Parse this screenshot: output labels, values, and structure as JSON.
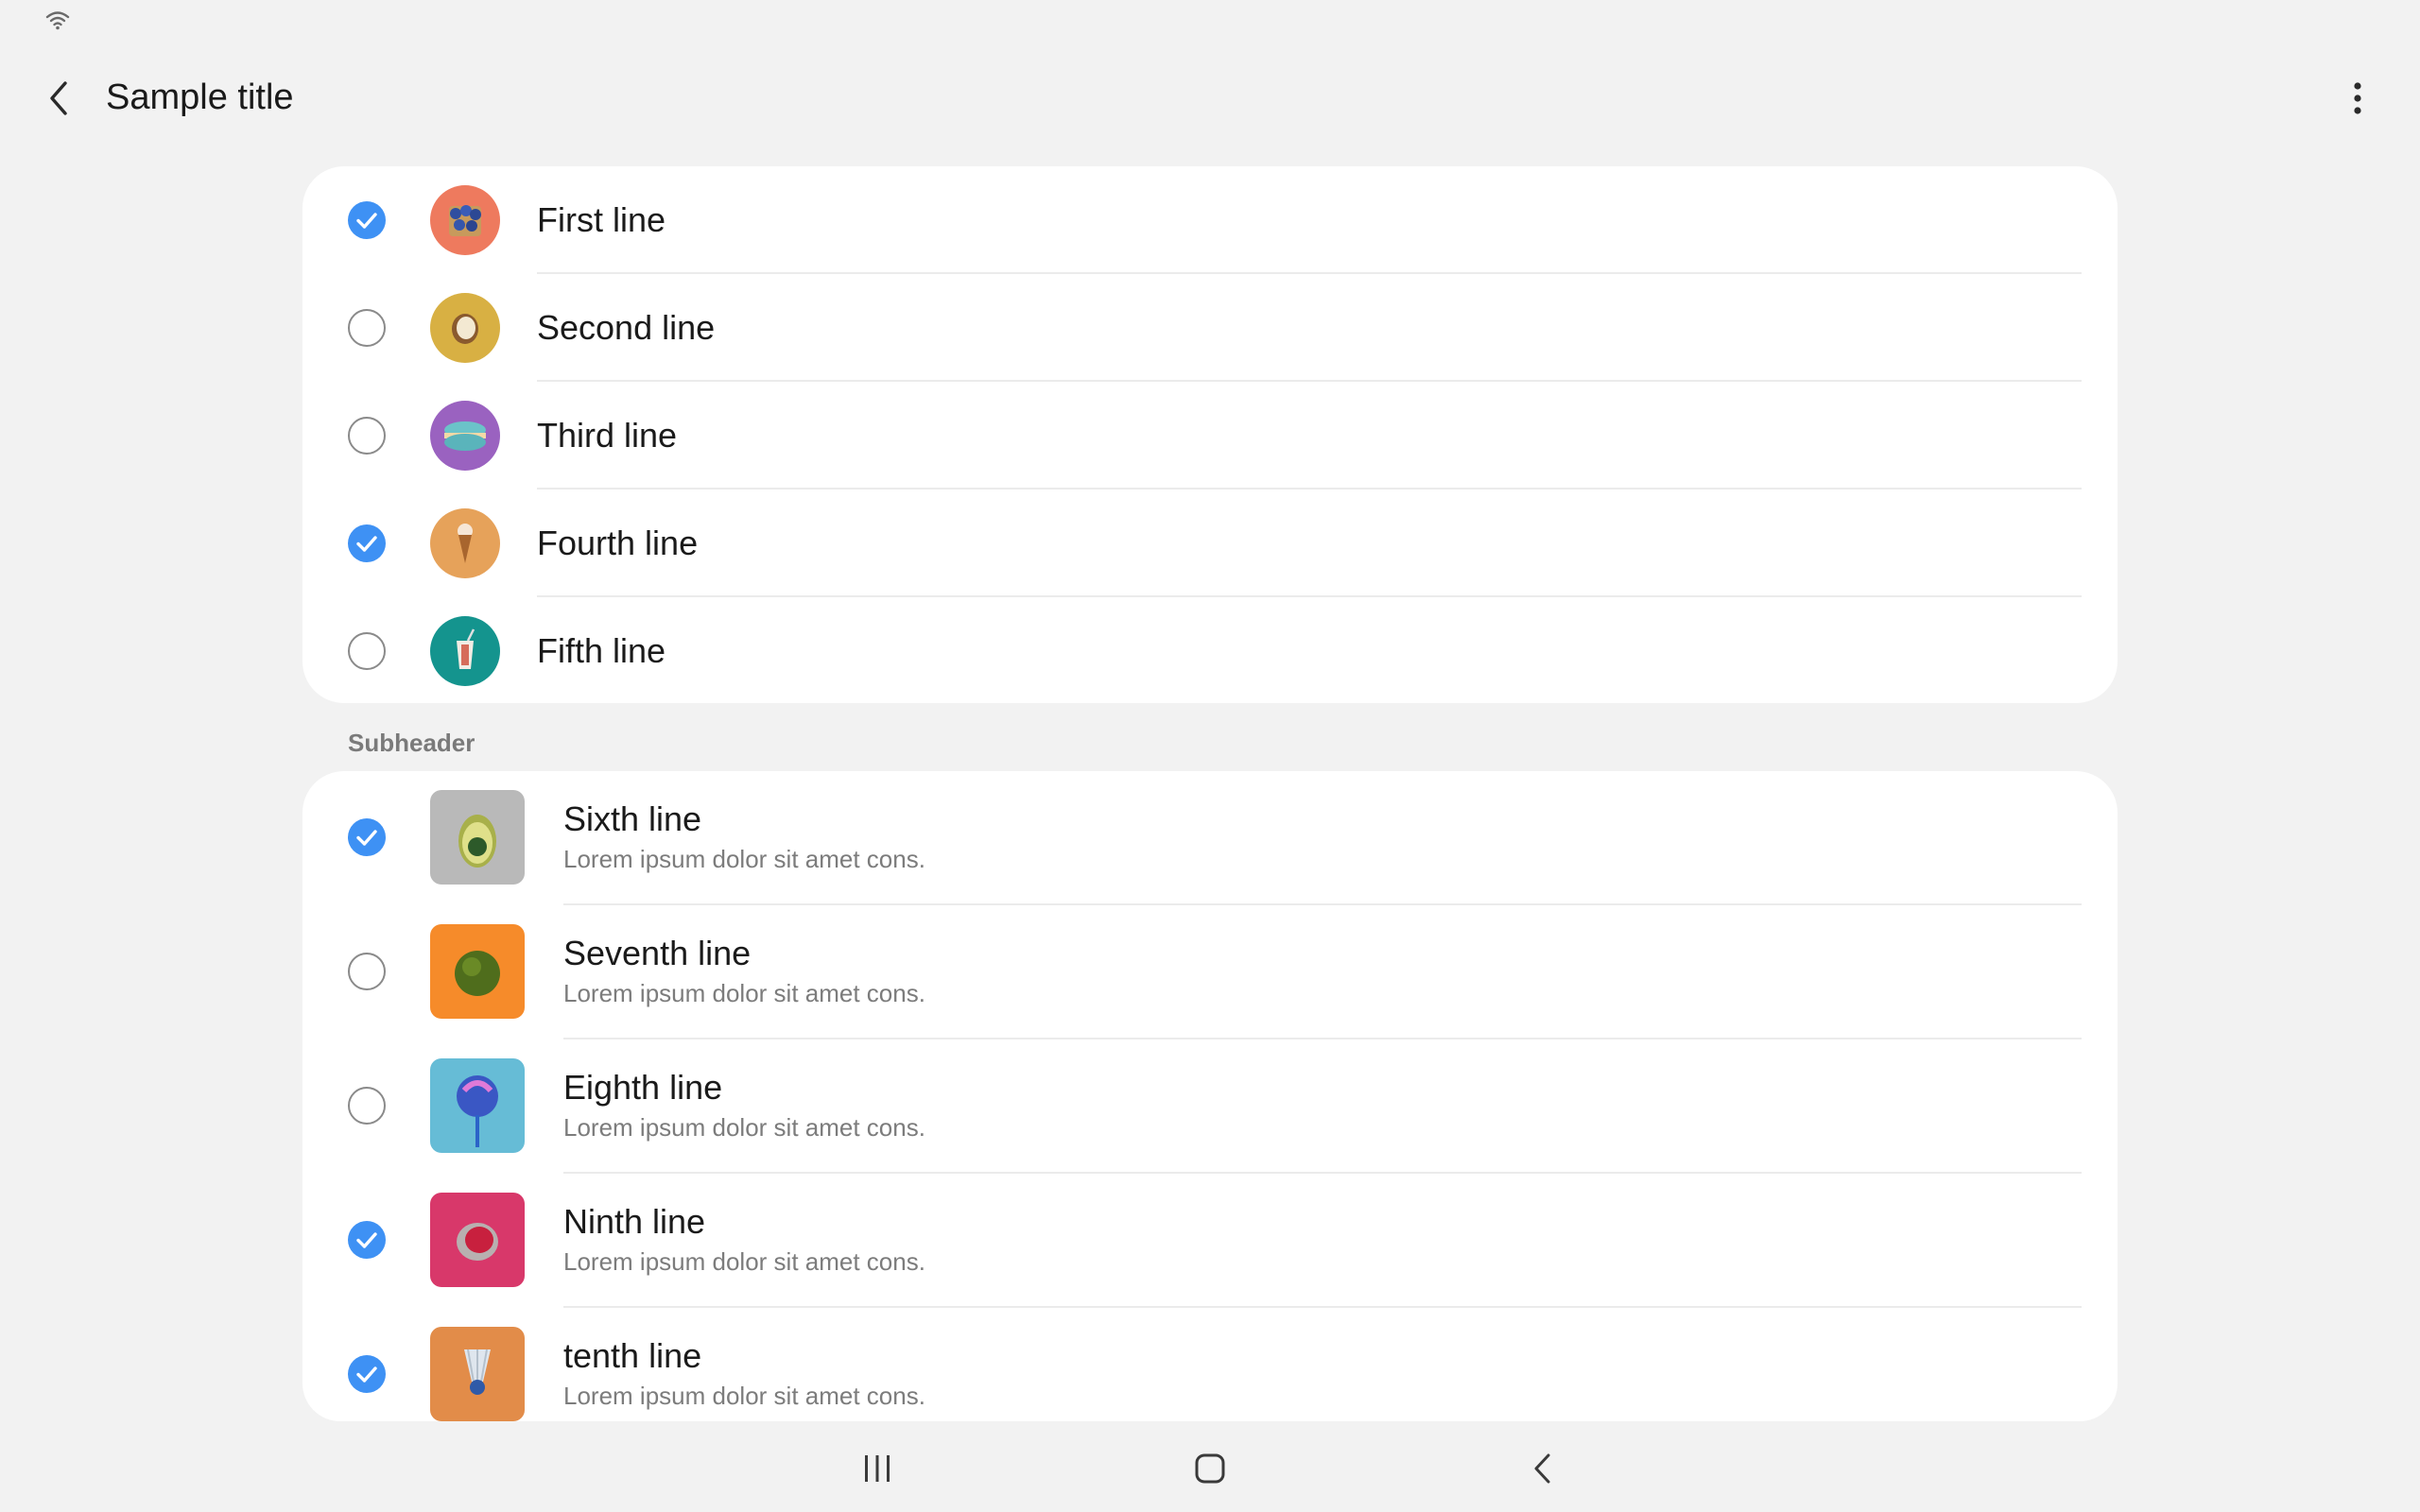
{
  "status_bar": {
    "icons": [
      "wifi-icon"
    ]
  },
  "app_bar": {
    "title": "Sample title",
    "back_icon": "chevron-left-icon",
    "menu_icon": "more-vertical-icon"
  },
  "accent_color": "#3e91f4",
  "list_1": {
    "items": [
      {
        "label": "First line",
        "checked": true,
        "image": "blueberries-basket",
        "bg": "#ee7a5e"
      },
      {
        "label": "Second line",
        "checked": false,
        "image": "halved-coconut",
        "bg": "#d8b043"
      },
      {
        "label": "Third line",
        "checked": false,
        "image": "macaron",
        "bg": "#9a62c0"
      },
      {
        "label": "Fourth line",
        "checked": true,
        "image": "ice-cream-cone",
        "bg": "#e6a25a"
      },
      {
        "label": "Fifth line",
        "checked": false,
        "image": "paper-cup",
        "bg": "#14948e"
      }
    ]
  },
  "subheader": "Subheader",
  "list_2": {
    "items": [
      {
        "label": "Sixth line",
        "subtitle": "Lorem ipsum dolor sit amet cons.",
        "checked": true,
        "image": "avocado",
        "bg": "#b9b9b9"
      },
      {
        "label": "Seventh line",
        "subtitle": "Lorem ipsum dolor sit amet cons.",
        "checked": false,
        "image": "green-ball",
        "bg": "#f68b2a"
      },
      {
        "label": "Eighth line",
        "subtitle": "Lorem ipsum dolor sit amet cons.",
        "checked": false,
        "image": "lollipop",
        "bg": "#66bcd6"
      },
      {
        "label": "Ninth line",
        "subtitle": "Lorem ipsum dolor sit amet cons.",
        "checked": true,
        "image": "raspberry-sweet",
        "bg": "#d8386a"
      },
      {
        "label": "tenth line",
        "subtitle": "Lorem ipsum dolor sit amet cons.",
        "checked": true,
        "image": "shuttlecock",
        "bg": "#e28c49"
      }
    ]
  },
  "nav_bar": {
    "icons": [
      "recents-icon",
      "home-icon",
      "back-icon"
    ]
  }
}
